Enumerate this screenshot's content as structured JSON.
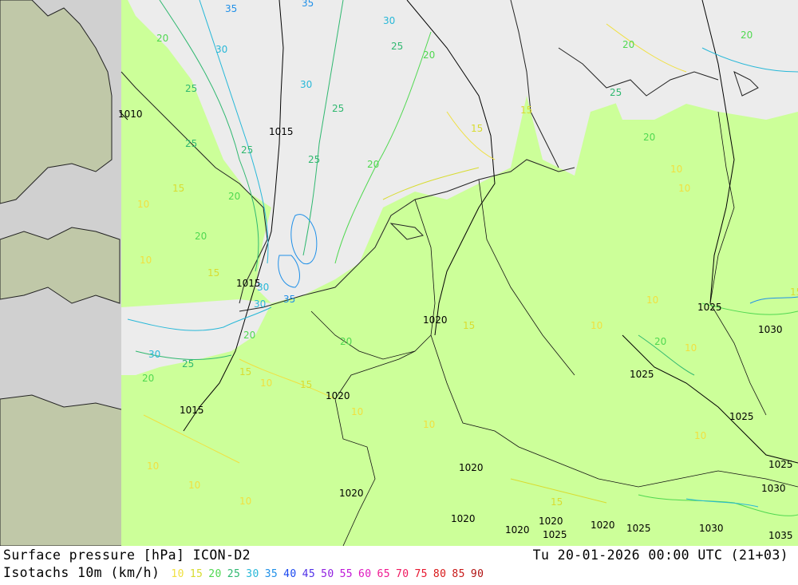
{
  "title": "Surface pressure [hPa] ICON-D2",
  "subtitle": "Isotachs 10m (km/h)",
  "datetime": "Tu 20-01-2026 00:00 UTC (21+03)",
  "legend": [
    {
      "value": "10",
      "color": "#f0e040"
    },
    {
      "value": "15",
      "color": "#d8dc30"
    },
    {
      "value": "20",
      "color": "#50d850"
    },
    {
      "value": "25",
      "color": "#30b870"
    },
    {
      "value": "30",
      "color": "#28b8d8"
    },
    {
      "value": "35",
      "color": "#2090e8"
    },
    {
      "value": "40",
      "color": "#1a48f0"
    },
    {
      "value": "45",
      "color": "#5030e8"
    },
    {
      "value": "50",
      "color": "#9020e0"
    },
    {
      "value": "55",
      "color": "#c018d8"
    },
    {
      "value": "60",
      "color": "#e018c0"
    },
    {
      "value": "65",
      "color": "#f01890"
    },
    {
      "value": "70",
      "color": "#f01860"
    },
    {
      "value": "75",
      "color": "#e81830"
    },
    {
      "value": "80",
      "color": "#d81818"
    },
    {
      "value": "85",
      "color": "#c81818"
    },
    {
      "value": "90",
      "color": "#b01010"
    }
  ],
  "colors": {
    "land_outside": "#c0c8a8",
    "sea_outside": "#d0d0d0",
    "domain_land": "#ccff99",
    "domain_sea": "#ececec",
    "isobar": "#000000"
  },
  "pressure_labels": [
    "1010",
    "1015",
    "1015",
    "1015",
    "1020",
    "1020",
    "1020",
    "1020",
    "1020",
    "1020",
    "1020",
    "1020",
    "1025",
    "1025",
    "1025",
    "1025",
    "1025",
    "1025",
    "1030",
    "1030",
    "1030",
    "1035"
  ],
  "isotach_labels": [
    "35",
    "30",
    "35",
    "25",
    "20",
    "20",
    "30",
    "25",
    "30",
    "25",
    "25",
    "20",
    "15",
    "20",
    "25",
    "20",
    "20",
    "15",
    "10",
    "10",
    "20",
    "25",
    "20",
    "15",
    "10",
    "10",
    "15",
    "20",
    "25",
    "30",
    "35",
    "10",
    "10",
    "15",
    "15",
    "20",
    "30",
    "30",
    "25",
    "20",
    "15",
    "20",
    "15",
    "10",
    "10",
    "10",
    "10",
    "15",
    "10",
    "10",
    "10",
    "10"
  ]
}
